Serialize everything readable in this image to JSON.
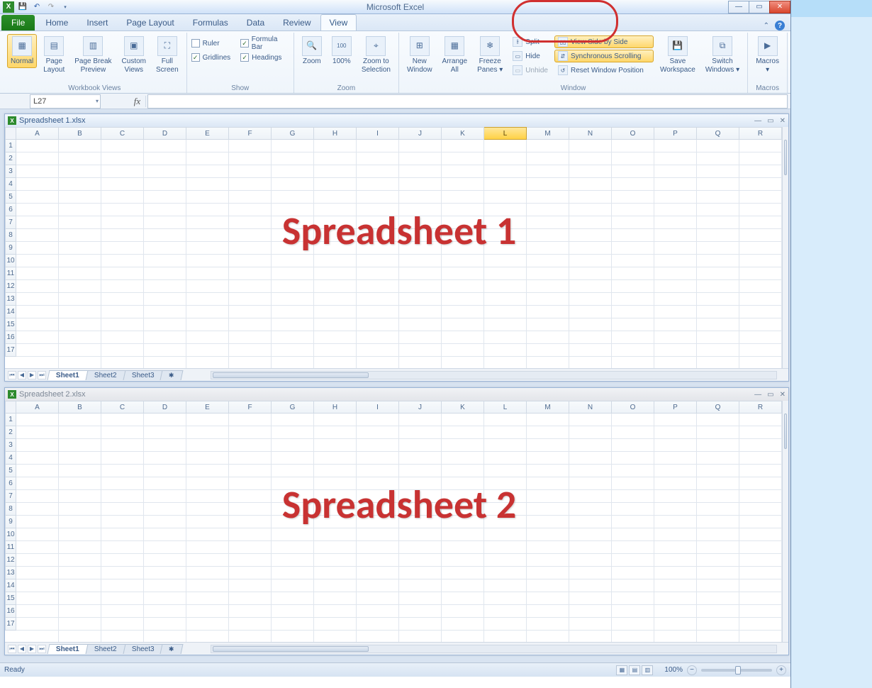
{
  "app_title": "Microsoft Excel",
  "qat": {
    "tooltip_save": "Save",
    "tooltip_undo": "Undo",
    "tooltip_redo": "Redo"
  },
  "tabs": {
    "file": "File",
    "items": [
      "Home",
      "Insert",
      "Page Layout",
      "Formulas",
      "Data",
      "Review",
      "View"
    ],
    "active": "View"
  },
  "ribbon": {
    "workbook_views": {
      "label": "Workbook Views",
      "normal": "Normal",
      "page_layout": "Page\nLayout",
      "page_break": "Page Break\nPreview",
      "custom_views": "Custom\nViews",
      "full_screen": "Full\nScreen"
    },
    "show": {
      "label": "Show",
      "ruler": "Ruler",
      "gridlines": "Gridlines",
      "formula_bar": "Formula Bar",
      "headings": "Headings",
      "ruler_checked": false,
      "gridlines_checked": true,
      "formula_bar_checked": true,
      "headings_checked": true
    },
    "zoom": {
      "label": "Zoom",
      "zoom": "Zoom",
      "hundred": "100%",
      "to_selection": "Zoom to\nSelection"
    },
    "window": {
      "label": "Window",
      "new_window": "New\nWindow",
      "arrange_all": "Arrange\nAll",
      "freeze_panes": "Freeze\nPanes ▾",
      "split": "Split",
      "hide": "Hide",
      "unhide": "Unhide",
      "view_side_by_side": "View Side by Side",
      "sync_scroll": "Synchronous Scrolling",
      "reset_pos": "Reset Window Position",
      "save_workspace": "Save\nWorkspace",
      "switch_windows": "Switch\nWindows ▾"
    },
    "macros": {
      "label": "Macros",
      "macros": "Macros\n▾"
    }
  },
  "name_box": "L27",
  "workbooks": [
    {
      "title": "Spreadsheet 1.xlsx",
      "active": true,
      "overlay": "Spreadsheet 1",
      "columns": [
        "A",
        "B",
        "C",
        "D",
        "E",
        "F",
        "G",
        "H",
        "I",
        "J",
        "K",
        "L",
        "M",
        "N",
        "O",
        "P",
        "Q",
        "R"
      ],
      "selected_col": "L",
      "rows": [
        "1",
        "2",
        "3",
        "4",
        "5",
        "6",
        "7",
        "8",
        "9",
        "10",
        "11",
        "12",
        "13",
        "14",
        "15",
        "16",
        "17"
      ],
      "sheets": [
        "Sheet1",
        "Sheet2",
        "Sheet3"
      ],
      "active_sheet": "Sheet1"
    },
    {
      "title": "Spreadsheet 2.xlsx",
      "active": false,
      "overlay": "Spreadsheet 2",
      "columns": [
        "A",
        "B",
        "C",
        "D",
        "E",
        "F",
        "G",
        "H",
        "I",
        "J",
        "K",
        "L",
        "M",
        "N",
        "O",
        "P",
        "Q",
        "R"
      ],
      "selected_col": "",
      "rows": [
        "1",
        "2",
        "3",
        "4",
        "5",
        "6",
        "7",
        "8",
        "9",
        "10",
        "11",
        "12",
        "13",
        "14",
        "15",
        "16",
        "17"
      ],
      "sheets": [
        "Sheet1",
        "Sheet2",
        "Sheet3"
      ],
      "active_sheet": "Sheet1"
    }
  ],
  "status": {
    "ready": "Ready",
    "zoom_pct": "100%"
  }
}
